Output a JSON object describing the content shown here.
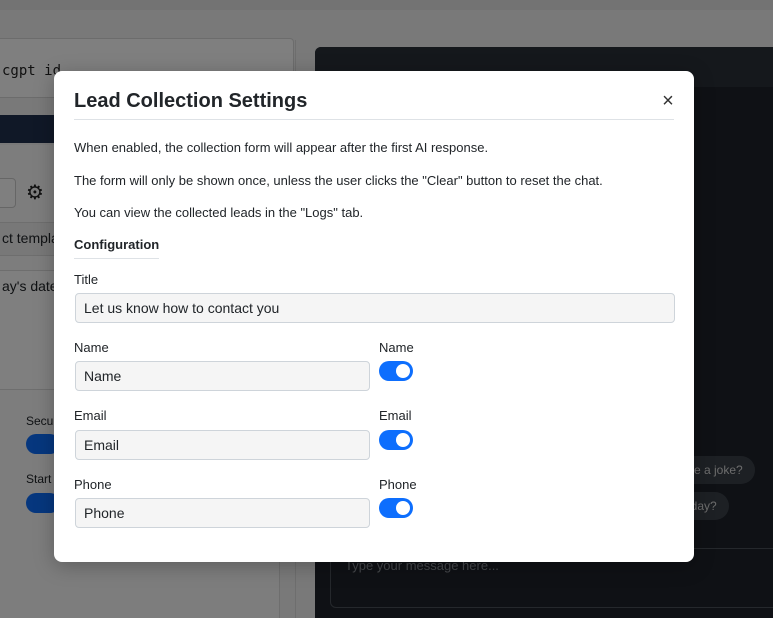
{
  "background": {
    "id_input_text": "cgpt id",
    "template_text": "ct templa",
    "date_text": "ay's date",
    "security_label": "Secu",
    "start_label": "Start",
    "chips": [
      "me a joke?",
      "oday?"
    ],
    "chat_placeholder": "Type your message here..."
  },
  "modal": {
    "title": "Lead Collection Settings",
    "close_label": "×",
    "paragraphs": [
      "When enabled, the collection form will appear after the first AI response.",
      "The form will only be shown once, unless the user clicks the \"Clear\" button to reset the chat.",
      "You can view the collected leads in the \"Logs\" tab."
    ],
    "section_label": "Configuration",
    "title_field": {
      "label": "Title",
      "value": "Let us know how to contact you"
    },
    "fields": [
      {
        "label": "Name",
        "value": "Name",
        "toggle_label": "Name",
        "enabled": true
      },
      {
        "label": "Email",
        "value": "Email",
        "toggle_label": "Email",
        "enabled": true
      },
      {
        "label": "Phone",
        "value": "Phone",
        "toggle_label": "Phone",
        "enabled": true
      }
    ]
  },
  "colors": {
    "accent": "#0d6efd",
    "overlay": "rgba(0,0,0,0.5)"
  }
}
